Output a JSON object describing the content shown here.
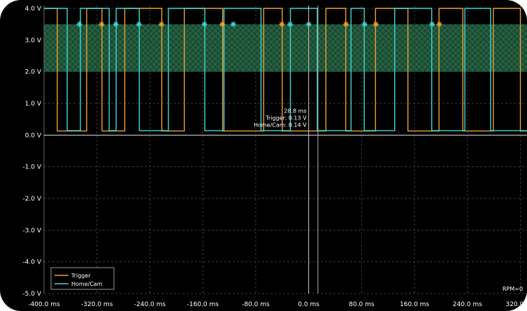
{
  "chart_data": {
    "type": "line",
    "title": "",
    "xlabel": "",
    "ylabel": "",
    "x_unit": "ms",
    "y_unit": "V",
    "xlim": [
      -400,
      330
    ],
    "ylim": [
      -5.0,
      4.0
    ],
    "x_ticks": [
      "-400.0 ms",
      "-320.0 ms",
      "-240.0 ms",
      "-160.0 ms",
      "-80.0 ms",
      "0.0 ms",
      "80.0 ms",
      "160.0 ms",
      "240.0 ms",
      "320.0 ms"
    ],
    "x_tick_values": [
      -400,
      -320,
      -240,
      -160,
      -80,
      0,
      80,
      160,
      240,
      320
    ],
    "y_ticks": [
      "4.0 V",
      "3.0 V",
      "2.0 V",
      "1.0 V",
      "0.0 V",
      "-1.0 V",
      "-2.0 V",
      "-3.0 V",
      "-4.0 V",
      "-5.0 V"
    ],
    "y_tick_values": [
      4,
      3,
      2,
      1,
      0,
      -1,
      -2,
      -3,
      -4,
      -5
    ],
    "grid": true,
    "legend_position": "bottom-left",
    "threshold_band": {
      "y_low": 2.0,
      "y_high": 3.5,
      "color": "#2e8b57"
    },
    "cursor": {
      "x": 0.0
    },
    "readout": {
      "x": 14.0,
      "time": "28.8 ms",
      "trigger": "Trigger: 0.13 V",
      "home_cam": "Home/Cam: 0.14 V"
    },
    "rpm_label": "RPM=0",
    "series": [
      {
        "name": "Trigger",
        "color": "#f0a030",
        "high": 4.0,
        "low": 0.13,
        "start_level": "high",
        "edges": [
          -380.0,
          -335.6,
          -312.4,
          -278.0,
          -222.0,
          -188.0,
          -130.0,
          -68.0,
          -40.0,
          26.0,
          56.0,
          101.0,
          150.0,
          197.0,
          233.0,
          279.0,
          320.0
        ]
      },
      {
        "name": "Home/Cam",
        "color": "#40d8d8",
        "high": 4.0,
        "low": 0.14,
        "start_level": "high",
        "edges": [
          -365.0,
          -345.0,
          -301.5,
          -291.0,
          -256.0,
          -212.0,
          -157.0,
          -128.0,
          -72.0,
          -27.6,
          13.0,
          64.0,
          84.0,
          130.0,
          186.0,
          236.0,
          275.0
        ]
      }
    ],
    "markers": [
      {
        "series": "Home/Cam",
        "x": -346.5,
        "y": 3.5
      },
      {
        "series": "Trigger",
        "x": -313.0,
        "y": 3.5
      },
      {
        "series": "Home/Cam",
        "x": -291.5,
        "y": 3.5
      },
      {
        "series": "Home/Cam",
        "x": -256.5,
        "y": 3.5
      },
      {
        "series": "Trigger",
        "x": -222.5,
        "y": 3.5
      },
      {
        "series": "Home/Cam",
        "x": -157.5,
        "y": 3.5
      },
      {
        "series": "Trigger",
        "x": -130.5,
        "y": 3.5
      },
      {
        "series": "Home/Cam",
        "x": -114.0,
        "y": 3.5
      },
      {
        "series": "Trigger",
        "x": -40.5,
        "y": 3.5
      },
      {
        "series": "Home/Cam",
        "x": -28.0,
        "y": 3.5
      },
      {
        "series": "Home/Cam",
        "x": 0.0,
        "y": 3.5
      },
      {
        "series": "Trigger",
        "x": 56.5,
        "y": 3.5
      },
      {
        "series": "Home/Cam",
        "x": 84.5,
        "y": 3.5
      },
      {
        "series": "Trigger",
        "x": 101.5,
        "y": 3.5
      },
      {
        "series": "Home/Cam",
        "x": 186.5,
        "y": 3.5
      },
      {
        "series": "Trigger",
        "x": 197.5,
        "y": 3.5
      }
    ]
  }
}
